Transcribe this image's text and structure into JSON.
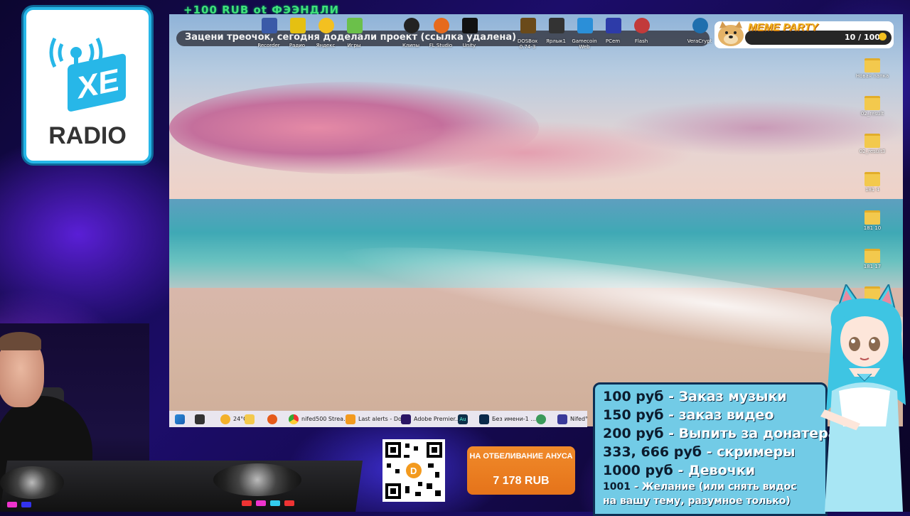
{
  "logo": {
    "text": "RADIO",
    "badge": "XE"
  },
  "top_donation": "+100 RUB  ot ФЭЭНДЛИ",
  "chat_message": "Зацени треочок, сегодня доделали проект (ссылка удалена)",
  "meme_party": {
    "title": "MEME PARTY",
    "count": "10 / 100"
  },
  "desktop_icons": [
    {
      "label": "Recorder"
    },
    {
      "label": "Радио"
    },
    {
      "label": "Яндекс"
    },
    {
      "label": "Игры"
    },
    {
      "label": "Клипы"
    },
    {
      "label": "FL Studio"
    },
    {
      "label": "Unity"
    },
    {
      "label": "DOSBox 0.74-3"
    },
    {
      "label": "Ярлык1"
    },
    {
      "label": "Gamecoin Web"
    },
    {
      "label": "PCem"
    },
    {
      "label": "Flash"
    },
    {
      "label": "VeraCrypt"
    }
  ],
  "desktop_folders": [
    {
      "label": "Новая папка"
    },
    {
      "label": "02_result"
    },
    {
      "label": "02_result3"
    },
    {
      "label": "181 4"
    },
    {
      "label": "181 10"
    },
    {
      "label": "181 17"
    },
    {
      "label": ""
    }
  ],
  "taskbar": {
    "weather": "24°C",
    "items": [
      {
        "label": "nifed500 Strea..."
      },
      {
        "label": "Last alerts - Do..."
      },
      {
        "label": "Adobe Premier..."
      },
      {
        "label": "Au"
      },
      {
        "label": "Без имени-1 ..."
      },
      {
        "label": "Nifed°"
      }
    ]
  },
  "goal": {
    "title": "НА ОТБЕЛИВАНИЕ АНУСА",
    "amount": "7 178 RUB"
  },
  "price_list": [
    {
      "amount": "100 руб",
      "desc": " - Заказ музыки"
    },
    {
      "amount": "150 руб",
      "desc": " - заказ видео"
    },
    {
      "amount": "200 руб",
      "desc": " - Выпить за донатера"
    },
    {
      "amount": "333, 666 руб",
      "desc": " - скримеры"
    },
    {
      "amount": "1000 руб",
      "desc": " - Девочки"
    },
    {
      "amount": "1001",
      "desc": " - Желание (или снять видос"
    },
    {
      "amount": "",
      "desc": "на вашу тему, разумное только)"
    }
  ],
  "colors": {
    "accent_orange": "#e5731a",
    "panel_blue": "#72cbe6",
    "logo_blue": "#27b7e8",
    "donation_green": "#3fe07a"
  }
}
